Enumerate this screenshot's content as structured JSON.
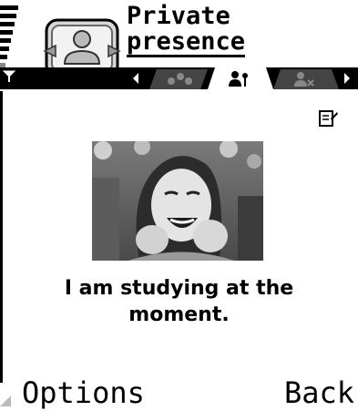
{
  "header": {
    "title_line1": "Private",
    "title_line2": "presence",
    "tabs": [
      {
        "icon": "public-presence-icon",
        "selected": false
      },
      {
        "icon": "private-presence-icon",
        "selected": true
      },
      {
        "icon": "blocked-presence-icon",
        "selected": false
      }
    ],
    "signal_level": 7
  },
  "content": {
    "message": "I am studying at the moment."
  },
  "softkeys": {
    "left": "Options",
    "right": "Back"
  },
  "colors": {
    "background": "#ffffff",
    "foreground": "#000000",
    "tab_bar": "#000000",
    "tab_inactive": "#808080"
  }
}
